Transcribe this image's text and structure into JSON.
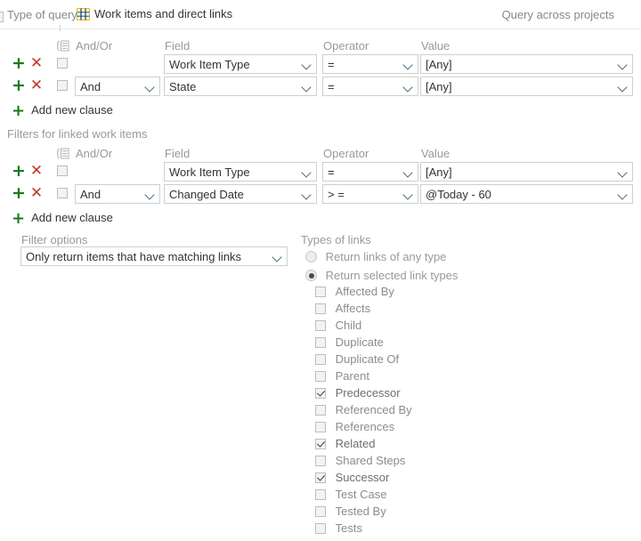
{
  "header": {
    "type_of_query_label": "Type of query",
    "query_type_value": "Work items and direct links",
    "query_type_icon": "grid-icon",
    "query_across_projects_label": "Query across projects",
    "query_across_projects_checked": false
  },
  "columns": {
    "and_or": "And/Or",
    "field": "Field",
    "operator": "Operator",
    "value": "Value",
    "group_icon": "group-clauses-icon"
  },
  "top_clauses": {
    "add_new_clause_label": "Add new clause",
    "rows": [
      {
        "add_icon": "add-clause-icon",
        "delete_icon": "delete-clause-icon",
        "selected": false,
        "and_or": "",
        "field": "Work Item Type",
        "operator": "=",
        "value": "[Any]"
      },
      {
        "add_icon": "add-clause-icon",
        "delete_icon": "delete-clause-icon",
        "selected": false,
        "and_or": "And",
        "field": "State",
        "operator": "=",
        "value": "[Any]"
      }
    ]
  },
  "linked_clauses": {
    "section_title": "Filters for linked work items",
    "add_new_clause_label": "Add new clause",
    "rows": [
      {
        "add_icon": "add-clause-icon",
        "delete_icon": "delete-clause-icon",
        "selected": false,
        "and_or": "",
        "field": "Work Item Type",
        "operator": "=",
        "value": "[Any]"
      },
      {
        "add_icon": "add-clause-icon",
        "delete_icon": "delete-clause-icon",
        "selected": false,
        "and_or": "And",
        "field": "Changed Date",
        "operator": "> =",
        "value": "@Today - 60"
      }
    ]
  },
  "filter_options": {
    "label": "Filter options",
    "value": "Only return items that have matching links"
  },
  "types_of_links": {
    "label": "Types of links",
    "radios": [
      {
        "label": "Return links of any type",
        "selected": false
      },
      {
        "label": "Return selected link types",
        "selected": true
      }
    ],
    "link_types": [
      {
        "label": "Affected By",
        "checked": false
      },
      {
        "label": "Affects",
        "checked": false
      },
      {
        "label": "Child",
        "checked": false
      },
      {
        "label": "Duplicate",
        "checked": false
      },
      {
        "label": "Duplicate Of",
        "checked": false
      },
      {
        "label": "Parent",
        "checked": false
      },
      {
        "label": "Predecessor",
        "checked": true
      },
      {
        "label": "Referenced By",
        "checked": false
      },
      {
        "label": "References",
        "checked": false
      },
      {
        "label": "Related",
        "checked": true
      },
      {
        "label": "Shared Steps",
        "checked": false
      },
      {
        "label": "Successor",
        "checked": true
      },
      {
        "label": "Test Case",
        "checked": false
      },
      {
        "label": "Tested By",
        "checked": false
      },
      {
        "label": "Tests",
        "checked": false
      }
    ]
  },
  "colors": {
    "add": "#1a7a1a",
    "delete": "#c0392b",
    "muted_text": "#9a9a9a",
    "text": "#333333",
    "border": "#cfcfcf",
    "chevron": "#4a6b82"
  }
}
